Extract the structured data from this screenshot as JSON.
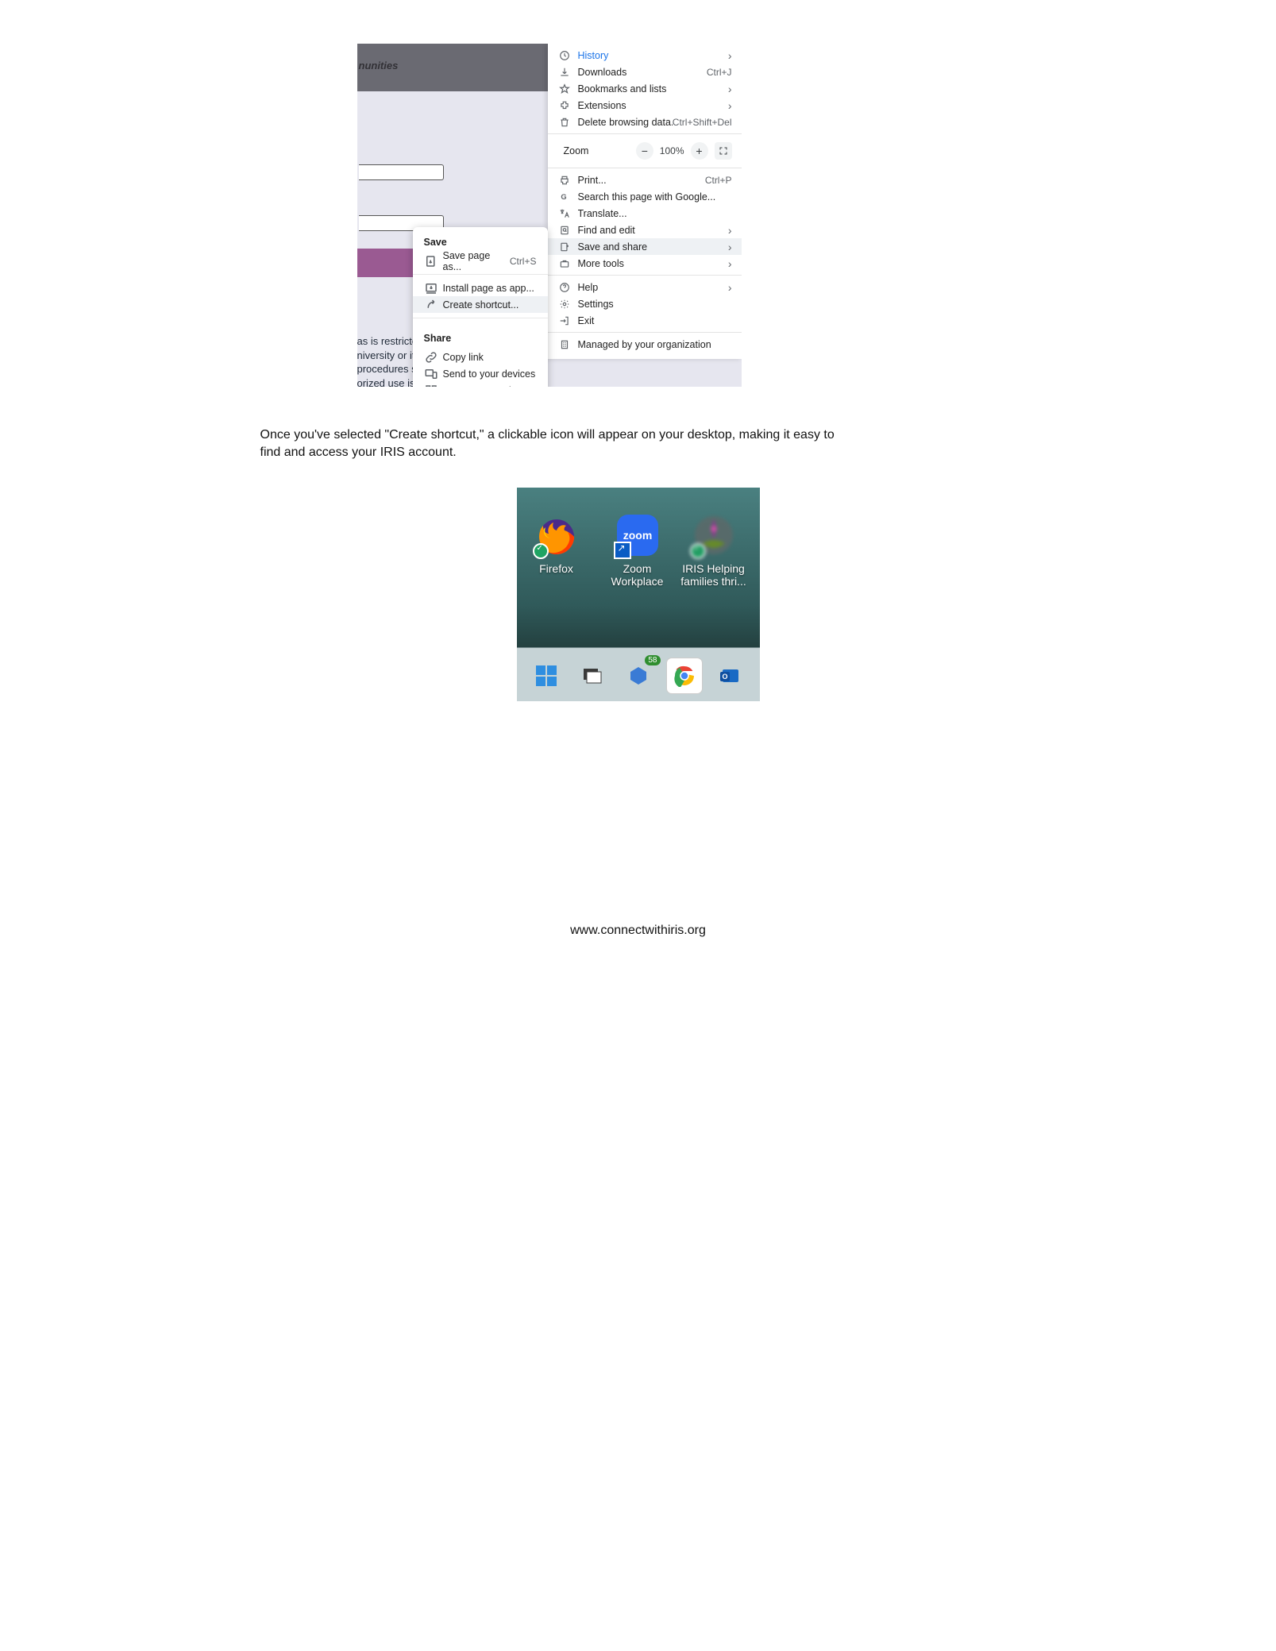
{
  "screenshot1": {
    "topbar_fragment": "nunities",
    "body_text_lines": [
      "as is restricte",
      "niversity or it",
      "procedures s",
      "orized use is"
    ]
  },
  "chrome_menu": {
    "items_a": [
      {
        "label": "History",
        "arrow": true,
        "link": true
      },
      {
        "label": "Downloads",
        "shortcut": "Ctrl+J"
      },
      {
        "label": "Bookmarks and lists",
        "arrow": true
      },
      {
        "label": "Extensions",
        "arrow": true
      },
      {
        "label": "Delete browsing data...",
        "shortcut": "Ctrl+Shift+Del"
      }
    ],
    "zoom": {
      "label": "Zoom",
      "percent": "100%"
    },
    "items_b": [
      {
        "label": "Print...",
        "shortcut": "Ctrl+P"
      },
      {
        "label": "Search this page with Google..."
      },
      {
        "label": "Translate..."
      },
      {
        "label": "Find and edit",
        "arrow": true
      },
      {
        "label": "Save and share",
        "arrow": true,
        "hover": true
      },
      {
        "label": "More tools",
        "arrow": true
      }
    ],
    "items_c": [
      {
        "label": "Help",
        "arrow": true
      },
      {
        "label": "Settings"
      },
      {
        "label": "Exit"
      }
    ],
    "items_d": [
      {
        "label": "Managed by your organization"
      }
    ]
  },
  "submenu": {
    "heading_save": "Save",
    "save_items": [
      {
        "label": "Save page as...",
        "shortcut": "Ctrl+S"
      }
    ],
    "install_items": [
      {
        "label": "Install page as app..."
      },
      {
        "label": "Create shortcut...",
        "hover": true
      }
    ],
    "heading_share": "Share",
    "share_items": [
      {
        "label": "Copy link"
      },
      {
        "label": "Send to your devices"
      },
      {
        "label": "Create QR Code"
      }
    ]
  },
  "paragraph": "Once you've selected \"Create shortcut,\" a clickable icon will appear on your desktop, making it easy to find and access your IRIS account.",
  "desktop": {
    "icons": {
      "firefox": "Firefox",
      "zoom_line1": "Zoom",
      "zoom_line2": "Workplace",
      "iris_line1": "IRIS   Helping",
      "iris_line2": "families thri..."
    },
    "taskbar_badge": "58"
  },
  "footer": "www.connectwithiris.org"
}
